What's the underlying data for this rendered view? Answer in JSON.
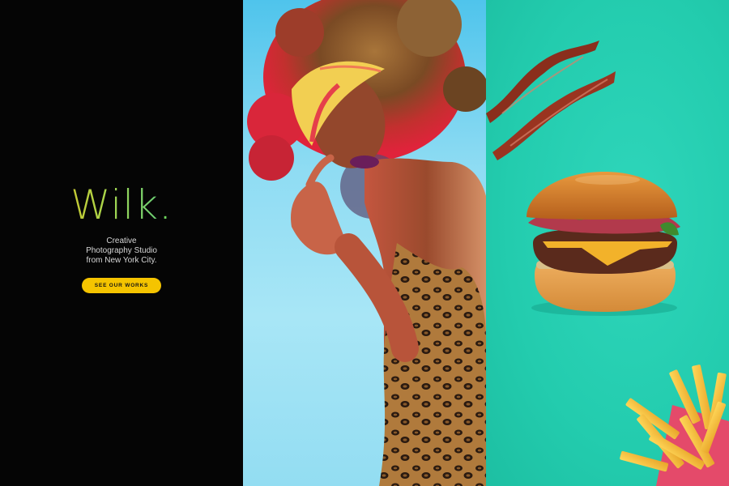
{
  "brand": {
    "logo_text": "Wilk",
    "logo_dot": ".",
    "tagline_lines": [
      "Creative",
      "Photography Studio",
      "from New York City."
    ]
  },
  "cta": {
    "label": "SEE OUR WORKS"
  },
  "colors": {
    "left_bg": "#050505",
    "accent_yellow": "#f5c400",
    "logo_green": "#6fd35a",
    "mid_bg": "#8fdcf3",
    "right_bg": "#23ccae"
  },
  "panels": {
    "portrait": {
      "subject": "portrait-photo"
    },
    "food": {
      "subject": "food-photo"
    }
  }
}
